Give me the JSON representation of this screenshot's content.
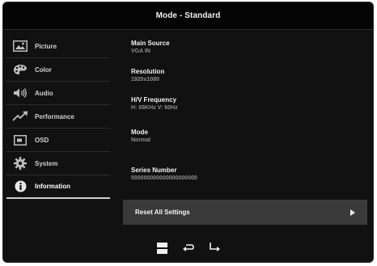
{
  "header": {
    "title": "Mode - Standard"
  },
  "sidebar": {
    "items": [
      {
        "label": "Picture",
        "icon": "picture-icon"
      },
      {
        "label": "Color",
        "icon": "palette-icon"
      },
      {
        "label": "Audio",
        "icon": "speaker-icon"
      },
      {
        "label": "Performance",
        "icon": "trend-icon"
      },
      {
        "label": "OSD",
        "icon": "osd-icon"
      },
      {
        "label": "System",
        "icon": "gear-icon"
      },
      {
        "label": "Information",
        "icon": "info-icon"
      }
    ],
    "active": "Information"
  },
  "info": {
    "main_source": {
      "label": "Main Source",
      "value": "VGA IN"
    },
    "resolution": {
      "label": "Resolution",
      "value": "1920x1080"
    },
    "frequency": {
      "label": "H/V Frequency",
      "value": "H: 68KHz V: 60Hz"
    },
    "mode": {
      "label": "Mode",
      "value": "Normal"
    },
    "serial": {
      "label": "Series Number",
      "value": "000000000000000000000"
    }
  },
  "reset": {
    "label": "Reset All Settings"
  },
  "footer": {
    "icons": [
      "menu-icon",
      "return-icon",
      "enter-icon"
    ]
  },
  "colors": {
    "background": "#111111",
    "title_bar": "#050505",
    "button": "#3a3a3a",
    "text": "#f2f2f2",
    "muted": "#8e8e8e"
  }
}
